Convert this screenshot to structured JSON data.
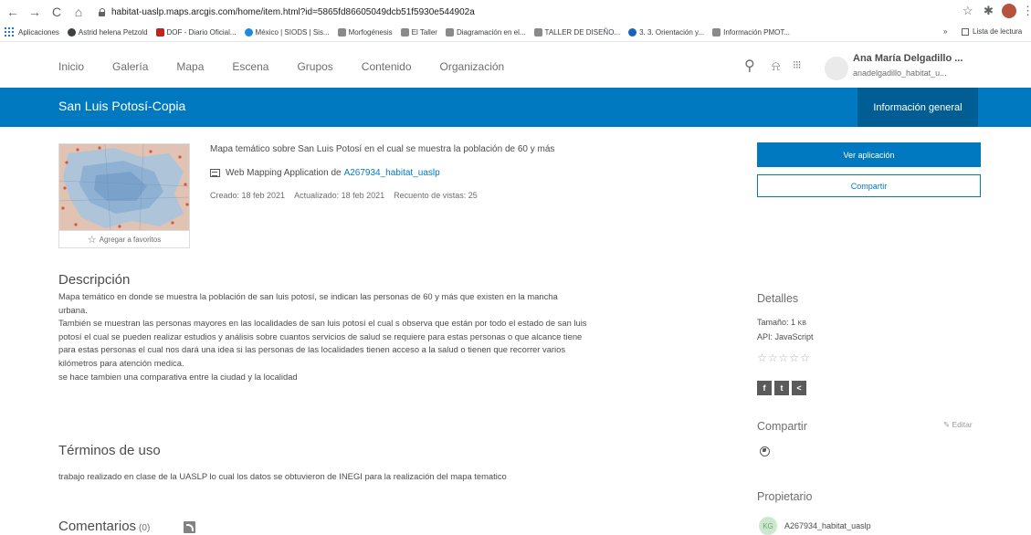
{
  "browser": {
    "url": "habitat-uaslp.maps.arcgis.com/home/item.html?id=5865fd86605049dcb51f5930e544902a",
    "bookmarks": [
      {
        "label": "Aplicaciones",
        "color": "#1a73e8"
      },
      {
        "label": "Astrid helena Petzold",
        "color": "#3c4043"
      },
      {
        "label": "DOF - Diario Oficial...",
        "color": "#c5221f"
      },
      {
        "label": "México | SIODS | Sis...",
        "color": "#1e88e5"
      },
      {
        "label": "Morfogénesis",
        "color": "#8a8a8a"
      },
      {
        "label": "El Taller",
        "color": "#8a8a8a"
      },
      {
        "label": "Diagramación en el...",
        "color": "#8a8a8a"
      },
      {
        "label": "TALLER DE DISEÑO...",
        "color": "#8a8a8a"
      },
      {
        "label": "3. 3. Orientación y...",
        "color": "#1565c0"
      },
      {
        "label": "Información PMOT...",
        "color": "#8a8a8a"
      }
    ],
    "overflow": "»",
    "reading_list": "Lista de lectura"
  },
  "nav": {
    "items": [
      "Inicio",
      "Galería",
      "Mapa",
      "Escena",
      "Grupos",
      "Contenido",
      "Organización"
    ]
  },
  "user": {
    "name": "Ana María Delgadillo ...",
    "username": "anadelgadillo_habitat_u..."
  },
  "item": {
    "title": "San Luis Potosí-Copia",
    "tab_label": "Información general",
    "summary": "Mapa temático sobre San Luis Potosí en el cual se muestra la población de 60 y más",
    "type_prefix": "Web Mapping Application de",
    "owner_link": "A267934_habitat_uaslp",
    "created": "Creado: 18 feb 2021",
    "updated": "Actualizado: 18 feb 2021",
    "views": "Recuento de vistas: 25",
    "favorite_label": "Agregar a favoritos"
  },
  "actions": {
    "view_app": "Ver aplicación",
    "share": "Compartir"
  },
  "description": {
    "heading": "Descripción",
    "lines": [
      "Mapa temático en donde se muestra la población de san luis potosí, se indican las personas de 60 y más que existen en la mancha",
      "urbana.",
      "También se muestran las personas mayores en las localidades de san luis potosí el cual s observa que están por todo el estado de san luis",
      "potosí el cual se pueden realizar estudios y análisis sobre cuantos servicios de salud se requiere para estas personas o que alcance tiene",
      "para estas personas el cual nos dará una idea si las personas de las localidades tienen acceso a la salud o tienen que recorrer varios",
      "kilómetros para atención medica.",
      "se hace tambien una comparativa entre la ciudad y la localidad"
    ]
  },
  "terms": {
    "heading": "Términos de uso",
    "text": "trabajo realizado en clase de la UASLP lo cual los datos se obtuvieron de INEGI para la realización del mapa tematico"
  },
  "comments": {
    "heading": "Comentarios",
    "count": "(0)"
  },
  "details": {
    "heading": "Detalles",
    "size_label": "Tamaño: 1",
    "size_unit": "KB",
    "api": "API: JavaScript",
    "rating": "☆☆☆☆☆",
    "social": {
      "facebook": "f",
      "twitter": "t",
      "share": "<"
    }
  },
  "share_section": {
    "heading": "Compartir",
    "edit_label": "Editar"
  },
  "owner": {
    "heading": "Propietario",
    "initials": "KG",
    "name": "A267934_habitat_uaslp"
  },
  "colors": {
    "brand_blue": "#0079c1",
    "tab_dark": "#005e95"
  }
}
